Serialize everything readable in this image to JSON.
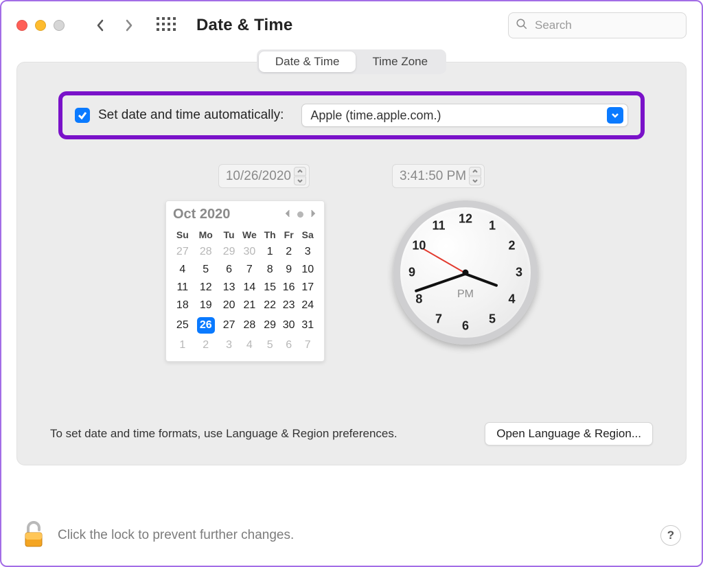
{
  "toolbar": {
    "title": "Date & Time",
    "search_placeholder": "Search"
  },
  "tabs": {
    "date_time": "Date & Time",
    "time_zone": "Time Zone",
    "active": "date_time"
  },
  "auto": {
    "checked": true,
    "label": "Set date and time automatically:",
    "server": "Apple (time.apple.com.)"
  },
  "date_field": "10/26/2020",
  "time_field": "3:41:50 PM",
  "calendar": {
    "title": "Oct 2020",
    "weekdays": [
      "Su",
      "Mo",
      "Tu",
      "We",
      "Th",
      "Fr",
      "Sa"
    ],
    "leading_dim": [
      27,
      28,
      29,
      30
    ],
    "days": [
      1,
      2,
      3,
      4,
      5,
      6,
      7,
      8,
      9,
      10,
      11,
      12,
      13,
      14,
      15,
      16,
      17,
      18,
      19,
      20,
      21,
      22,
      23,
      24,
      25,
      26,
      27,
      28,
      29,
      30,
      31
    ],
    "trailing_dim": [
      1,
      2,
      3,
      4,
      5,
      6,
      7
    ],
    "selected": 26
  },
  "clock": {
    "ampm": "PM",
    "hour": 3,
    "minute": 41,
    "second": 50
  },
  "footer": {
    "hint": "To set date and time formats, use Language & Region preferences.",
    "button": "Open Language & Region..."
  },
  "bottom": {
    "text": "Click the lock to prevent further changes.",
    "help": "?"
  },
  "colors": {
    "accent": "#0a7aff",
    "highlight_border": "#7a12c9"
  }
}
